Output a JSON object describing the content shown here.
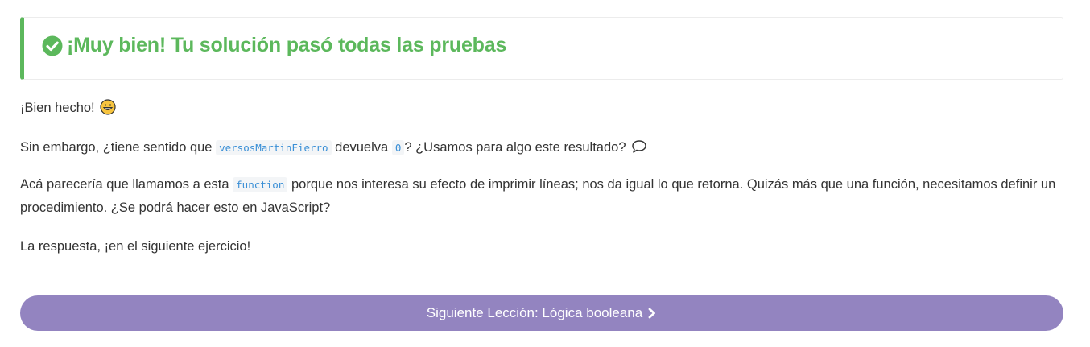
{
  "result": {
    "title": "¡Muy bien! Tu solución pasó todas las pruebas",
    "icon": "check-circle-icon",
    "color": "#5cb85c"
  },
  "feedback": {
    "p1": {
      "text": "¡Bien hecho!",
      "emoji": "grinning-face-icon"
    },
    "p2": {
      "before": "Sin embargo, ¿tiene sentido que",
      "code1": "versosMartinFierro",
      "middle": "devuelva",
      "code2": "0",
      "after": "? ¿Usamos para algo este resultado?",
      "icon": "speech-bubble-icon"
    },
    "p3": {
      "before": "Acá parecería que llamamos a esta",
      "code": "function",
      "after_line1": "porque nos interesa su efecto de imprimir líneas; nos da igual lo que retorna. Quizás más que una función, necesitamos definir un",
      "line2": "procedimiento. ¿Se podrá hacer esto en JavaScript?"
    },
    "p4": {
      "text": "La respuesta, ¡en el siguiente ejercicio!"
    }
  },
  "next_button": {
    "label": "Siguiente Lección: Lógica booleana",
    "icon": "chevron-right-icon",
    "color": "#9384c0"
  }
}
